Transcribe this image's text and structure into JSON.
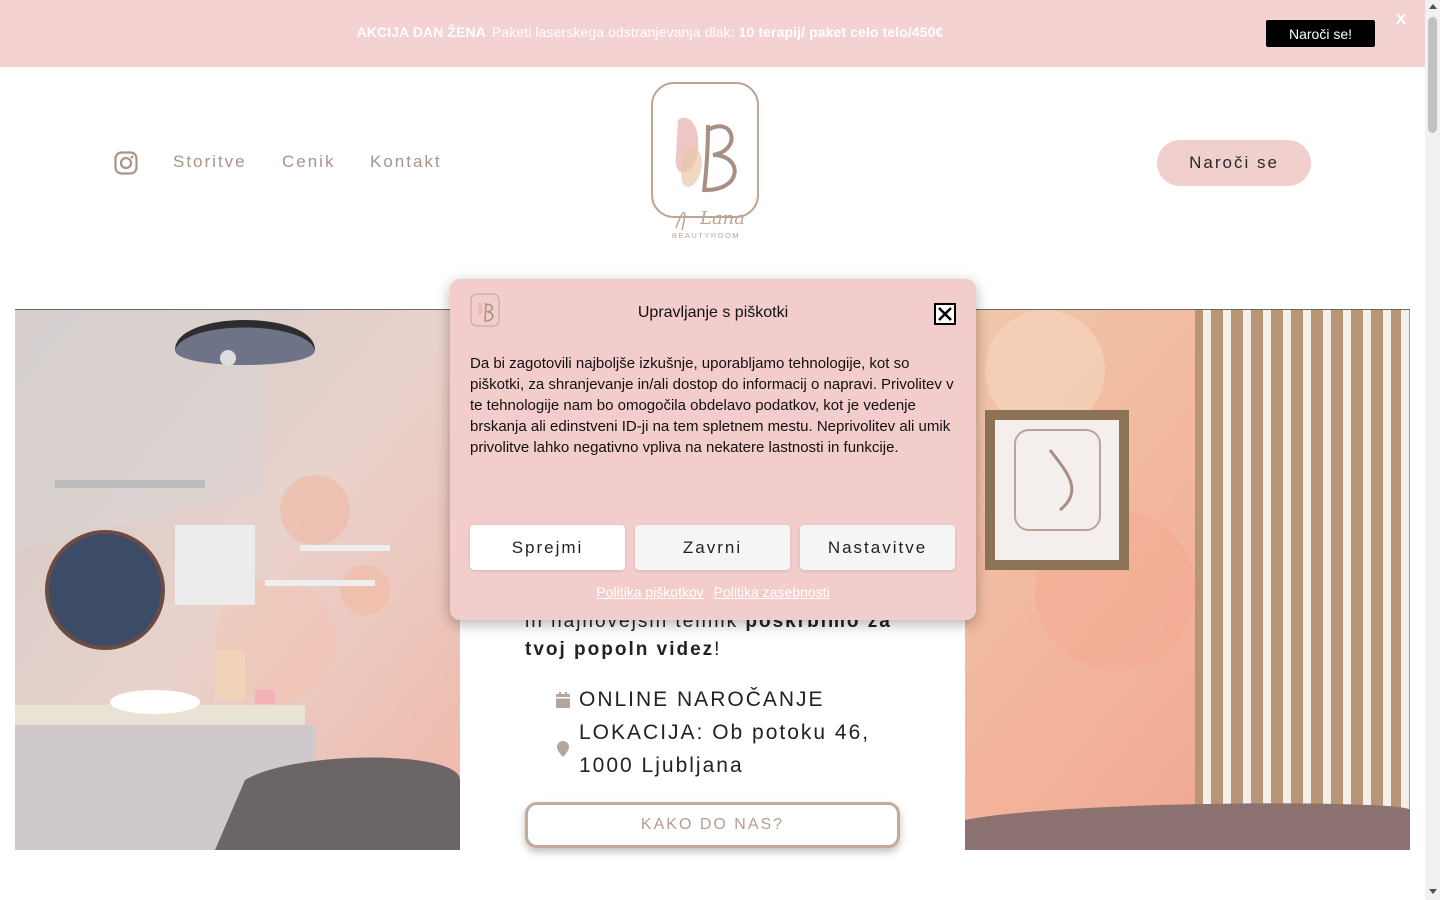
{
  "promo": {
    "bold_label": "AKCIJA DAN ŽENA",
    "text": "Paketi laserskega  odstranjevanja dlak:",
    "highlight": "10 terapij/ paket celo telo/450€",
    "button": "Naroči se!",
    "close": "X"
  },
  "header": {
    "nav": [
      "Storitve",
      "Cenik",
      "Kontakt"
    ],
    "book_button": "Naroči se",
    "logo_text": "Lana",
    "logo_subtext": "BEAUTYROOM"
  },
  "hero": {
    "text_pre": "in najnovejših tehnik ",
    "text_bold1": "poskrbimo za",
    "text_bold2": "tvoj popoln videz",
    "text_post": "!",
    "booking": "ONLINE NAROČANJE",
    "location_line1": "LOKACIJA: Ob potoku 46,",
    "location_line2": "1000 Ljubljana",
    "directions_button": "KAKO DO NAS?"
  },
  "cookie": {
    "title": "Upravljanje s piškotki",
    "body": "Da bi zagotovili najboljše izkušnje, uporabljamo tehnologije, kot so piškotki, za shranjevanje in/ali dostop do informacij o napravi. Privolitev v te tehnologije nam bo omogočila obdelavo podatkov, kot je vedenje brskanja ali edinstveni ID-ji na tem spletnem mestu. Neprivolitev ali umik privolitve lahko negativno vpliva na nekatere lastnosti in funkcije.",
    "buttons": [
      "Sprejmi",
      "Zavrni",
      "Nastavitve"
    ],
    "links": [
      "Politika piškotkov",
      "Politika zasebnosti"
    ]
  },
  "colors": {
    "promo_bg": "#f3d2d1",
    "accent_pink": "#f1cfcd",
    "nav_text": "#a8948a",
    "modal_bg": "#f3cdcb"
  }
}
